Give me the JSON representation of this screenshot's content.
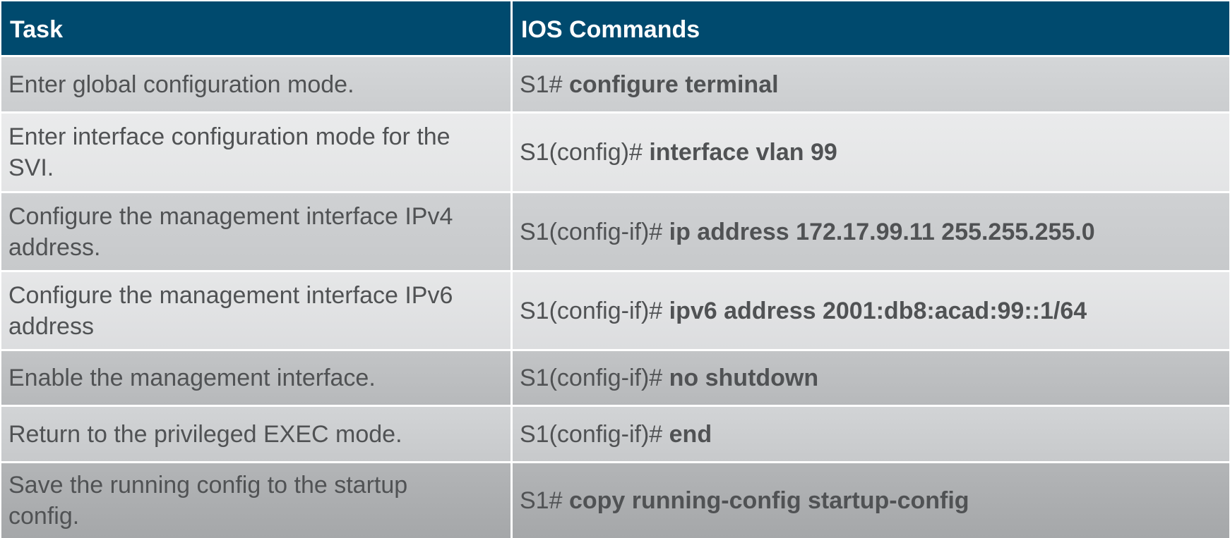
{
  "table": {
    "headers": {
      "task": "Task",
      "commands": "IOS Commands"
    },
    "rows": [
      {
        "task": "Enter global configuration mode.",
        "prompt": "S1# ",
        "command": "configure terminal"
      },
      {
        "task": "Enter interface configuration mode for the SVI.",
        "prompt": "S1(config)# ",
        "command": "interface vlan 99"
      },
      {
        "task": "Configure the management interface IPv4 address.",
        "prompt": "S1(config-if)# ",
        "command": "ip address 172.17.99.11 255.255.255.0"
      },
      {
        "task": "Configure the management interface IPv6 address",
        "prompt": "S1(config-if)# ",
        "command": "ipv6 address 2001:db8:acad:99::1/64"
      },
      {
        "task": "Enable the management interface.",
        "prompt": "S1(config-if)# ",
        "command": "no shutdown"
      },
      {
        "task": "Return to the privileged EXEC mode.",
        "prompt": "S1(config-if)# ",
        "command": "end"
      },
      {
        "task": "Save the running config to the startup config.",
        "prompt": "S1# ",
        "command": "copy running-config startup-config"
      }
    ]
  },
  "colors": {
    "header_bg": "#004a6e",
    "header_text": "#ffffff",
    "body_text": "#505254"
  }
}
